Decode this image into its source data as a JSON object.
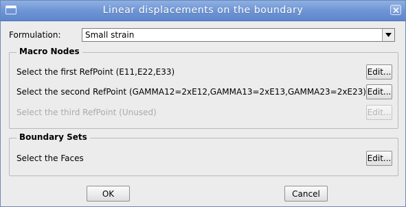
{
  "window": {
    "title": "Linear displacements on the boundary"
  },
  "formulation": {
    "label": "Formulation:",
    "value": "Small strain"
  },
  "macro_nodes": {
    "title": "Macro Nodes",
    "rows": [
      {
        "label": "Select the first RefPoint (E11,E22,E33)",
        "button": "Edit...",
        "enabled": true
      },
      {
        "label": "Select the second RefPoint (GAMMA12=2xE12,GAMMA13=2xE13,GAMMA23=2xE23)",
        "button": "Edit...",
        "enabled": true
      },
      {
        "label": "Select the third RefPoint (Unused)",
        "button": "Edit...",
        "enabled": false
      }
    ]
  },
  "boundary_sets": {
    "title": "Boundary Sets",
    "rows": [
      {
        "label": "Select the Faces",
        "button": "Edit...",
        "enabled": true
      }
    ]
  },
  "buttons": {
    "ok": "OK",
    "cancel": "Cancel"
  },
  "colors": {
    "titlebar": "#6f95d4",
    "dialog_bg": "#ececec",
    "disabled_text": "#aaaaaa"
  },
  "icons": {
    "window_menu": "window-icon",
    "close": "close-icon",
    "dropdown": "dropdown-arrow-icon"
  }
}
